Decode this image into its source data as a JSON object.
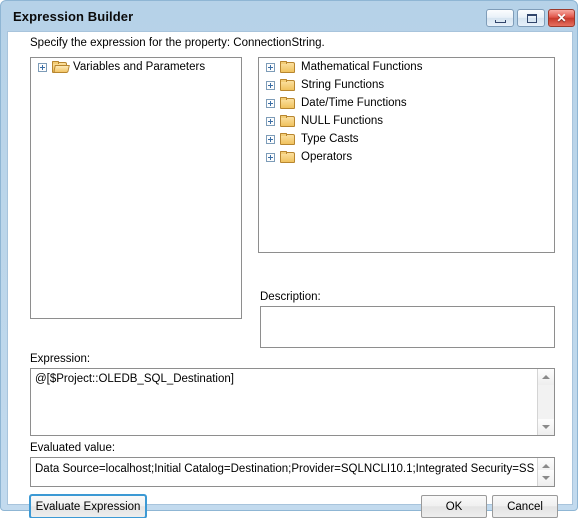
{
  "window": {
    "title": "Expression Builder",
    "controls": {
      "minimize": "Minimize",
      "maximize": "Maximize",
      "close": "✕"
    }
  },
  "prompt": "Specify the expression for the property: ConnectionString.",
  "variables_tree": {
    "items": [
      {
        "label": "Variables and Parameters",
        "icon": "folder-open-icon",
        "expander": "plus-box-icon"
      }
    ]
  },
  "functions_tree": {
    "items": [
      {
        "label": "Mathematical Functions",
        "icon": "folder-icon",
        "expander": "plus-box-icon"
      },
      {
        "label": "String Functions",
        "icon": "folder-icon",
        "expander": "plus-box-icon"
      },
      {
        "label": "Date/Time Functions",
        "icon": "folder-icon",
        "expander": "plus-box-icon"
      },
      {
        "label": "NULL Functions",
        "icon": "folder-icon",
        "expander": "plus-box-icon"
      },
      {
        "label": "Type Casts",
        "icon": "folder-icon",
        "expander": "plus-box-icon"
      },
      {
        "label": "Operators",
        "icon": "folder-icon",
        "expander": "plus-box-icon"
      }
    ]
  },
  "description": {
    "label": "Description:",
    "value": ""
  },
  "expression": {
    "label": "Expression:",
    "value": "@[$Project::OLEDB_SQL_Destination]"
  },
  "evaluated_value": {
    "label": "Evaluated value:",
    "value": "Data Source=localhost;Initial Catalog=Destination;Provider=SQLNCLI10.1;Integrated Security=SSPI;"
  },
  "buttons": {
    "evaluate": "Evaluate Expression",
    "ok": "OK",
    "cancel": "Cancel"
  },
  "colors": {
    "title_bar_start": "#b6d2e8",
    "title_bar_end": "#c2daee",
    "close_button": "#c73a2c",
    "focus_ring": "#3c99d4",
    "folder": "#f0c25e",
    "panel_border": "#8e8e8e"
  }
}
